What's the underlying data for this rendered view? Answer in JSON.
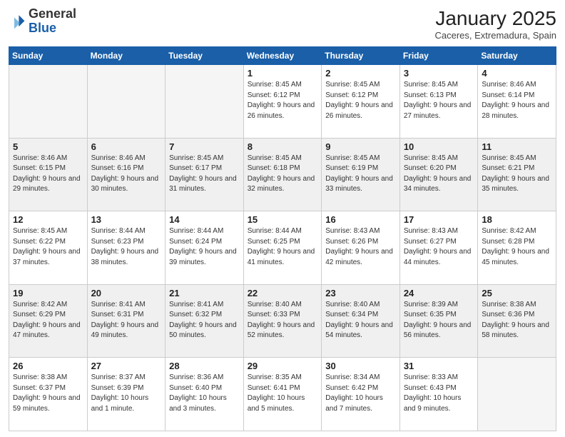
{
  "logo": {
    "general": "General",
    "blue": "Blue"
  },
  "title": "January 2025",
  "location": "Caceres, Extremadura, Spain",
  "days": [
    "Sunday",
    "Monday",
    "Tuesday",
    "Wednesday",
    "Thursday",
    "Friday",
    "Saturday"
  ],
  "weeks": [
    [
      {
        "day": "",
        "text": ""
      },
      {
        "day": "",
        "text": ""
      },
      {
        "day": "",
        "text": ""
      },
      {
        "day": "1",
        "text": "Sunrise: 8:45 AM\nSunset: 6:12 PM\nDaylight: 9 hours and 26 minutes."
      },
      {
        "day": "2",
        "text": "Sunrise: 8:45 AM\nSunset: 6:12 PM\nDaylight: 9 hours and 26 minutes."
      },
      {
        "day": "3",
        "text": "Sunrise: 8:45 AM\nSunset: 6:13 PM\nDaylight: 9 hours and 27 minutes."
      },
      {
        "day": "4",
        "text": "Sunrise: 8:46 AM\nSunset: 6:14 PM\nDaylight: 9 hours and 28 minutes."
      }
    ],
    [
      {
        "day": "5",
        "text": "Sunrise: 8:46 AM\nSunset: 6:15 PM\nDaylight: 9 hours and 29 minutes."
      },
      {
        "day": "6",
        "text": "Sunrise: 8:46 AM\nSunset: 6:16 PM\nDaylight: 9 hours and 30 minutes."
      },
      {
        "day": "7",
        "text": "Sunrise: 8:45 AM\nSunset: 6:17 PM\nDaylight: 9 hours and 31 minutes."
      },
      {
        "day": "8",
        "text": "Sunrise: 8:45 AM\nSunset: 6:18 PM\nDaylight: 9 hours and 32 minutes."
      },
      {
        "day": "9",
        "text": "Sunrise: 8:45 AM\nSunset: 6:19 PM\nDaylight: 9 hours and 33 minutes."
      },
      {
        "day": "10",
        "text": "Sunrise: 8:45 AM\nSunset: 6:20 PM\nDaylight: 9 hours and 34 minutes."
      },
      {
        "day": "11",
        "text": "Sunrise: 8:45 AM\nSunset: 6:21 PM\nDaylight: 9 hours and 35 minutes."
      }
    ],
    [
      {
        "day": "12",
        "text": "Sunrise: 8:45 AM\nSunset: 6:22 PM\nDaylight: 9 hours and 37 minutes."
      },
      {
        "day": "13",
        "text": "Sunrise: 8:44 AM\nSunset: 6:23 PM\nDaylight: 9 hours and 38 minutes."
      },
      {
        "day": "14",
        "text": "Sunrise: 8:44 AM\nSunset: 6:24 PM\nDaylight: 9 hours and 39 minutes."
      },
      {
        "day": "15",
        "text": "Sunrise: 8:44 AM\nSunset: 6:25 PM\nDaylight: 9 hours and 41 minutes."
      },
      {
        "day": "16",
        "text": "Sunrise: 8:43 AM\nSunset: 6:26 PM\nDaylight: 9 hours and 42 minutes."
      },
      {
        "day": "17",
        "text": "Sunrise: 8:43 AM\nSunset: 6:27 PM\nDaylight: 9 hours and 44 minutes."
      },
      {
        "day": "18",
        "text": "Sunrise: 8:42 AM\nSunset: 6:28 PM\nDaylight: 9 hours and 45 minutes."
      }
    ],
    [
      {
        "day": "19",
        "text": "Sunrise: 8:42 AM\nSunset: 6:29 PM\nDaylight: 9 hours and 47 minutes."
      },
      {
        "day": "20",
        "text": "Sunrise: 8:41 AM\nSunset: 6:31 PM\nDaylight: 9 hours and 49 minutes."
      },
      {
        "day": "21",
        "text": "Sunrise: 8:41 AM\nSunset: 6:32 PM\nDaylight: 9 hours and 50 minutes."
      },
      {
        "day": "22",
        "text": "Sunrise: 8:40 AM\nSunset: 6:33 PM\nDaylight: 9 hours and 52 minutes."
      },
      {
        "day": "23",
        "text": "Sunrise: 8:40 AM\nSunset: 6:34 PM\nDaylight: 9 hours and 54 minutes."
      },
      {
        "day": "24",
        "text": "Sunrise: 8:39 AM\nSunset: 6:35 PM\nDaylight: 9 hours and 56 minutes."
      },
      {
        "day": "25",
        "text": "Sunrise: 8:38 AM\nSunset: 6:36 PM\nDaylight: 9 hours and 58 minutes."
      }
    ],
    [
      {
        "day": "26",
        "text": "Sunrise: 8:38 AM\nSunset: 6:37 PM\nDaylight: 9 hours and 59 minutes."
      },
      {
        "day": "27",
        "text": "Sunrise: 8:37 AM\nSunset: 6:39 PM\nDaylight: 10 hours and 1 minute."
      },
      {
        "day": "28",
        "text": "Sunrise: 8:36 AM\nSunset: 6:40 PM\nDaylight: 10 hours and 3 minutes."
      },
      {
        "day": "29",
        "text": "Sunrise: 8:35 AM\nSunset: 6:41 PM\nDaylight: 10 hours and 5 minutes."
      },
      {
        "day": "30",
        "text": "Sunrise: 8:34 AM\nSunset: 6:42 PM\nDaylight: 10 hours and 7 minutes."
      },
      {
        "day": "31",
        "text": "Sunrise: 8:33 AM\nSunset: 6:43 PM\nDaylight: 10 hours and 9 minutes."
      },
      {
        "day": "",
        "text": ""
      }
    ]
  ]
}
